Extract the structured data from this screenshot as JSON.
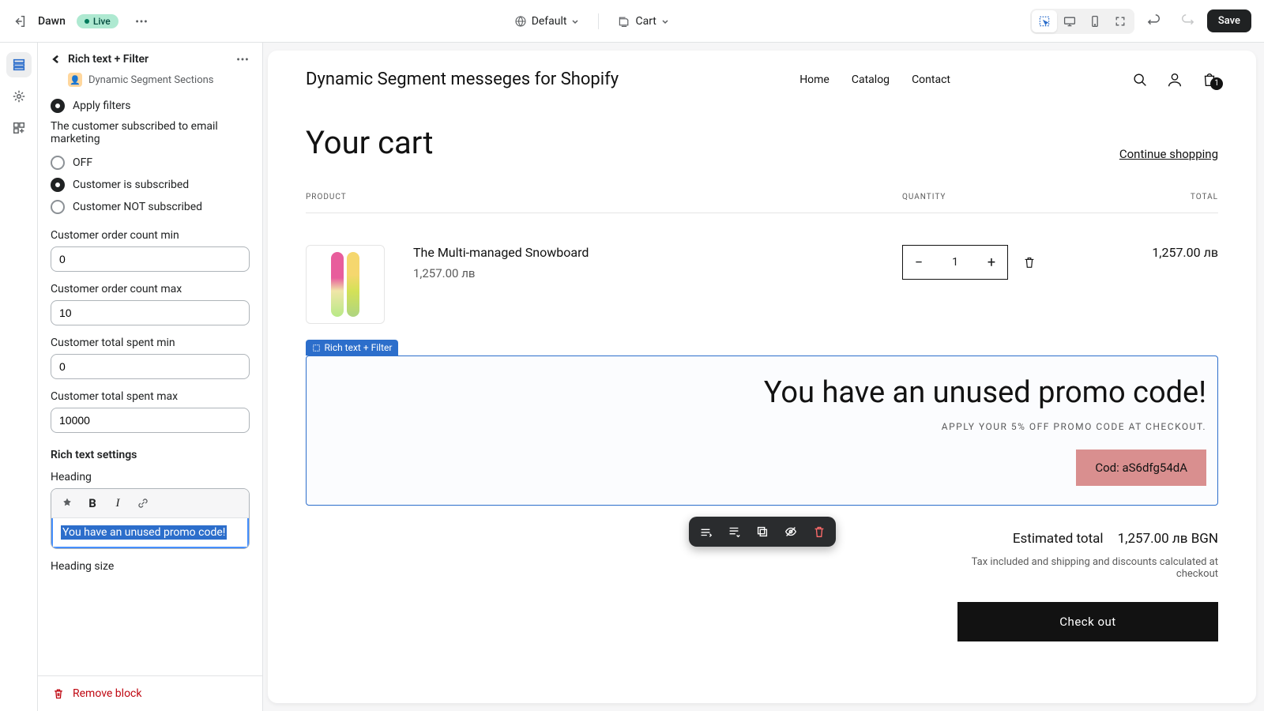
{
  "topbar": {
    "theme_name": "Dawn",
    "status_badge": "Live",
    "default_label": "Default",
    "cart_label": "Cart",
    "save_label": "Save"
  },
  "sidebar": {
    "title": "Rich text + Filter",
    "subtitle": "Dynamic Segment Sections",
    "apply_filters_label": "Apply filters",
    "email_section_label": "The customer subscribed to email marketing",
    "radio_off": "OFF",
    "radio_sub": "Customer is subscribed",
    "radio_notsub": "Customer NOT subscribed",
    "order_min_label": "Customer order count min",
    "order_min_value": "0",
    "order_max_label": "Customer order count max",
    "order_max_value": "10",
    "spent_min_label": "Customer total spent min",
    "spent_min_value": "0",
    "spent_max_label": "Customer total spent max",
    "spent_max_value": "10000",
    "rte_heading": "Rich text settings",
    "heading_label": "Heading",
    "heading_value": "You have an unused promo code!",
    "heading_size_label": "Heading size",
    "remove_block": "Remove block"
  },
  "preview": {
    "store_title": "Dynamic Segment messeges for Shopify",
    "nav": {
      "home": "Home",
      "catalog": "Catalog",
      "contact": "Contact"
    },
    "cart_badge": "1",
    "cart_title": "Your cart",
    "continue": "Continue shopping",
    "cols": {
      "product": "PRODUCT",
      "quantity": "QUANTITY",
      "total": "TOTAL"
    },
    "item": {
      "name": "The Multi-managed Snowboard",
      "price": "1,257.00 лв",
      "qty": "1",
      "total": "1,257.00 лв"
    },
    "block_tag": "Rich text + Filter",
    "promo_heading": "You have an unused promo code!",
    "promo_sub": "APPLY YOUR 5% OFF PROMO CODE AT CHECKOUT.",
    "promo_code": "Cod: aS6dfg54dA",
    "est_total_label": "Estimated total",
    "est_total_value": "1,257.00 лв BGN",
    "tax_note": "Tax included and shipping and discounts calculated at checkout",
    "checkout": "Check out"
  }
}
